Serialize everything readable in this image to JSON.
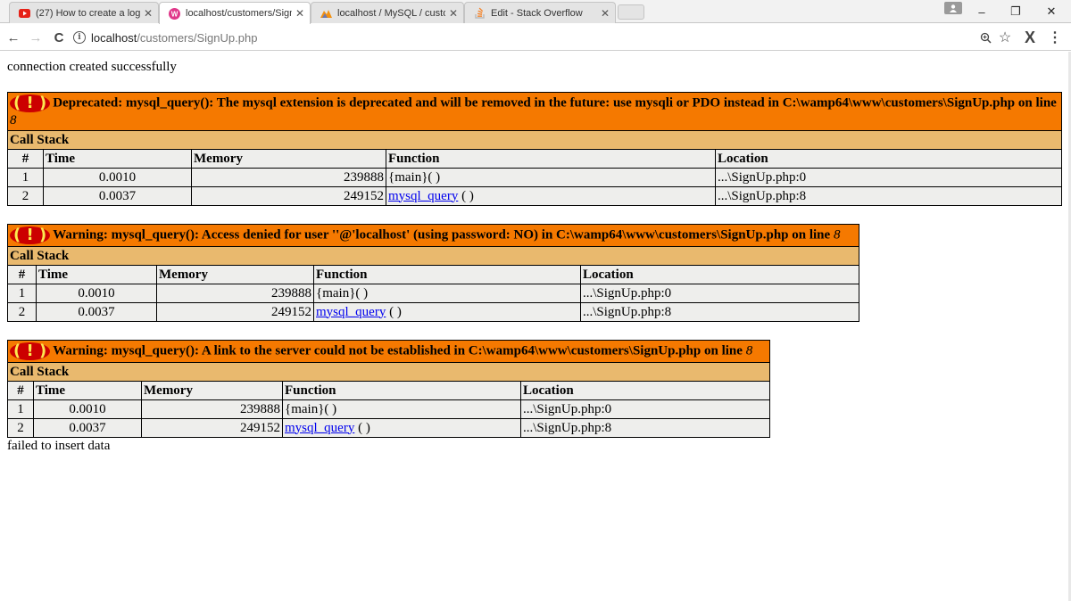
{
  "browser": {
    "tabs": [
      {
        "title": "(27) How to create a logi",
        "icon": "youtube-icon",
        "active": false
      },
      {
        "title": "localhost/customers/Sign",
        "icon": "wamp-icon",
        "active": true
      },
      {
        "title": "localhost / MySQL / custo",
        "icon": "phpmyadmin-icon",
        "active": false
      },
      {
        "title": "Edit - Stack Overflow",
        "icon": "stackoverflow-icon",
        "active": false
      }
    ],
    "url_host": "localhost",
    "url_path": "/customers/SignUp.php",
    "window_buttons": {
      "minimize": "–",
      "restore": "❐",
      "close": "✕"
    },
    "nav": {
      "back": "←",
      "forward": "→",
      "reload": "C"
    }
  },
  "page": {
    "line_top": "connection created successfully",
    "line_bottom": "failed to insert data",
    "errors": [
      {
        "badge": "( ! )",
        "message": "Deprecated: mysql_query(): The mysql extension is deprecated and will be removed in the future: use mysqli or PDO instead in C:\\wamp64\\www\\customers\\SignUp.php on line ",
        "line": "8",
        "call_stack_label": "Call Stack",
        "columns": [
          "#",
          "Time",
          "Memory",
          "Function",
          "Location"
        ],
        "rows": [
          {
            "num": "1",
            "time": "0.0010",
            "memory": "239888",
            "func": "{main}",
            "func_suffix": "( )",
            "func_link": false,
            "location": "...\\SignUp.php:0"
          },
          {
            "num": "2",
            "time": "0.0037",
            "memory": "249152",
            "func": "mysql_query",
            "func_suffix": " ( )",
            "func_link": true,
            "location": "...\\SignUp.php:8"
          }
        ]
      },
      {
        "badge": "( ! )",
        "message": "Warning: mysql_query(): Access denied for user ''@'localhost' (using password: NO) in C:\\wamp64\\www\\customers\\SignUp.php on line ",
        "line": "8",
        "call_stack_label": "Call Stack",
        "columns": [
          "#",
          "Time",
          "Memory",
          "Function",
          "Location"
        ],
        "rows": [
          {
            "num": "1",
            "time": "0.0010",
            "memory": "239888",
            "func": "{main}",
            "func_suffix": "( )",
            "func_link": false,
            "location": "...\\SignUp.php:0"
          },
          {
            "num": "2",
            "time": "0.0037",
            "memory": "249152",
            "func": "mysql_query",
            "func_suffix": " ( )",
            "func_link": true,
            "location": "...\\SignUp.php:8"
          }
        ]
      },
      {
        "badge": "( ! )",
        "message": "Warning: mysql_query(): A link to the server could not be established in C:\\wamp64\\www\\customers\\SignUp.php on line ",
        "line": "8",
        "call_stack_label": "Call Stack",
        "columns": [
          "#",
          "Time",
          "Memory",
          "Function",
          "Location"
        ],
        "rows": [
          {
            "num": "1",
            "time": "0.0010",
            "memory": "239888",
            "func": "{main}",
            "func_suffix": "( )",
            "func_link": false,
            "location": "...\\SignUp.php:0"
          },
          {
            "num": "2",
            "time": "0.0037",
            "memory": "249152",
            "func": "mysql_query",
            "func_suffix": " ( )",
            "func_link": true,
            "location": "...\\SignUp.php:8"
          }
        ]
      }
    ]
  },
  "colors": {
    "error_header": "#f57900",
    "call_stack_header": "#e9b96e",
    "cell_bg": "#eeeeec",
    "badge_bg": "#cc0000",
    "badge_fg": "#fce94f",
    "link": "#0000ee"
  }
}
